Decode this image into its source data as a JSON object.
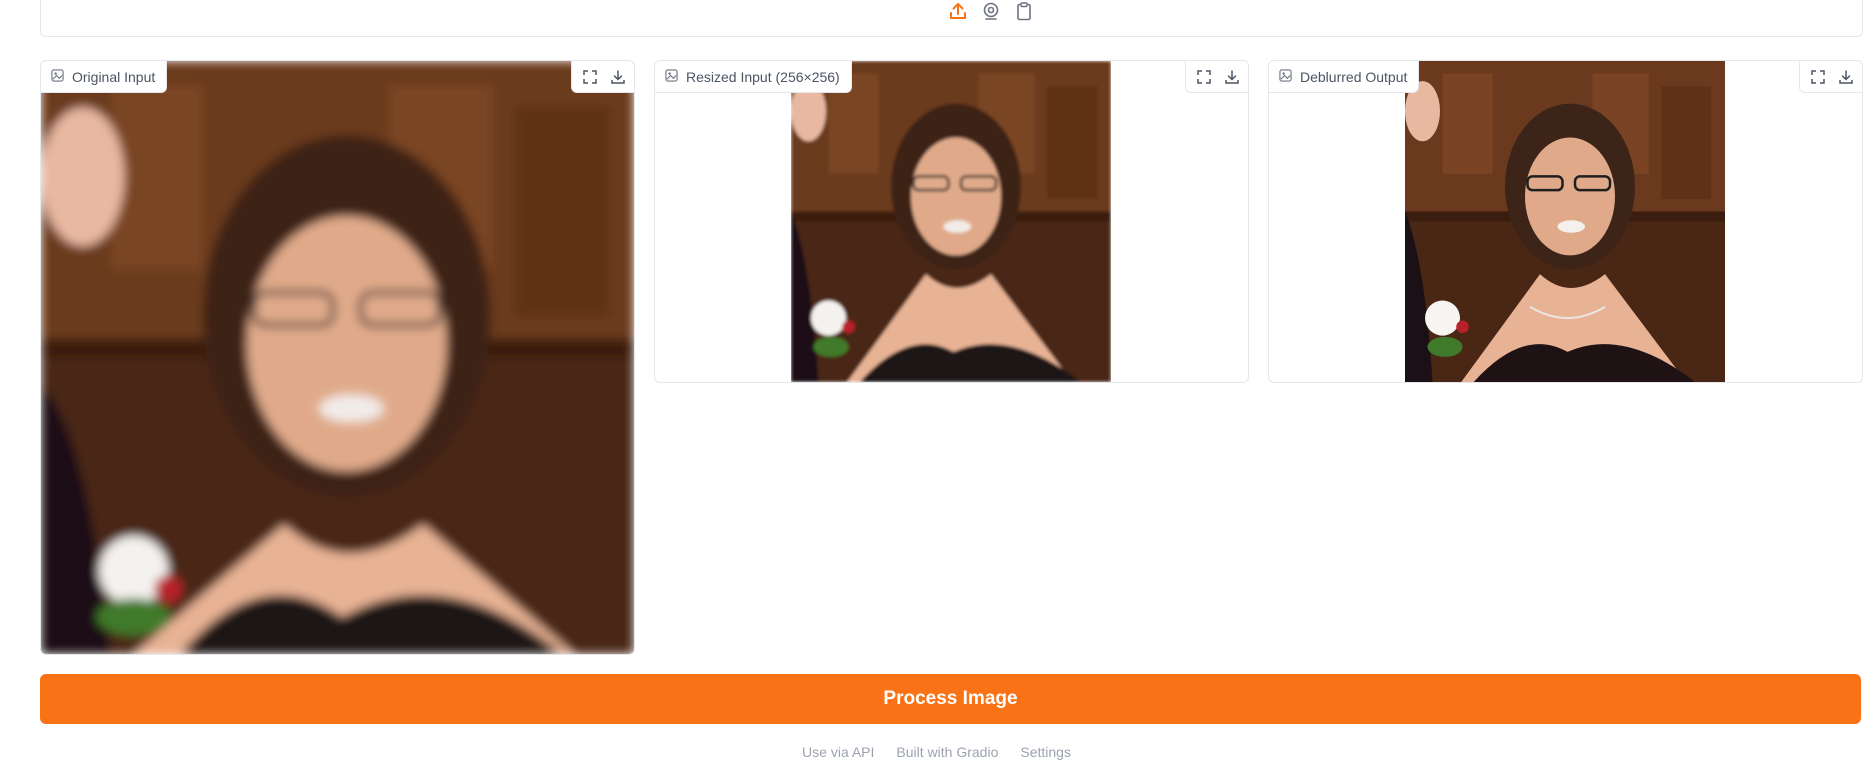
{
  "source": {
    "icons": [
      "upload-icon",
      "webcam-icon",
      "clipboard-icon"
    ],
    "active_color": "#f97316"
  },
  "panels": [
    {
      "label": "Original Input",
      "tools": [
        "fullscreen-icon",
        "download-icon"
      ]
    },
    {
      "label": "Resized Input (256×256)",
      "tools": [
        "fullscreen-icon",
        "download-icon"
      ]
    },
    {
      "label": "Deblurred Output",
      "tools": [
        "fullscreen-icon",
        "download-icon"
      ]
    }
  ],
  "actions": {
    "process_label": "Process Image"
  },
  "footer": {
    "api": "Use via API",
    "built": "Built with Gradio",
    "settings": "Settings"
  },
  "colors": {
    "accent": "#f97316",
    "border": "#e5e7eb",
    "label_text": "#4b5563"
  }
}
